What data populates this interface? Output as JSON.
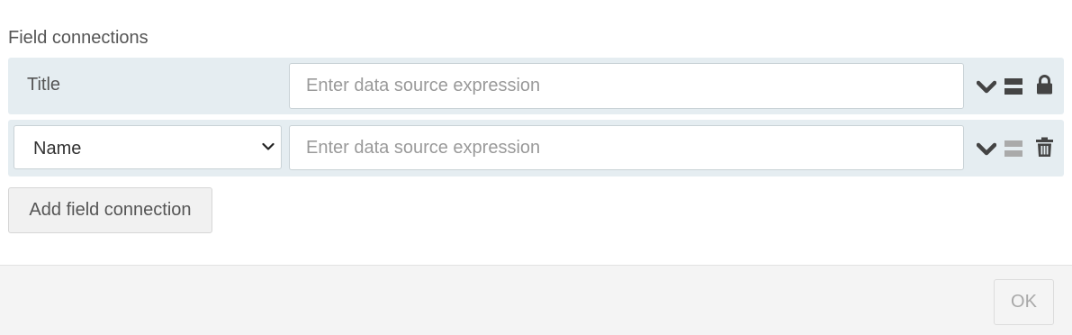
{
  "section": {
    "label": "Field connections"
  },
  "connections": [
    {
      "field": "Title",
      "field_editable": false,
      "expression_value": "",
      "expression_placeholder": "Enter data source expression",
      "action_icon": "lock-icon"
    },
    {
      "field": "Name",
      "field_editable": true,
      "expression_value": "",
      "expression_placeholder": "Enter data source expression",
      "action_icon": "trash-icon"
    }
  ],
  "add_button": {
    "label": "Add field connection"
  },
  "footer": {
    "ok_label": "OK"
  },
  "colors": {
    "row_background": "#e5edf1",
    "icon_dark": "#444444",
    "icon_muted": "#aaaaaa",
    "footer_background": "#f4f4f4"
  }
}
